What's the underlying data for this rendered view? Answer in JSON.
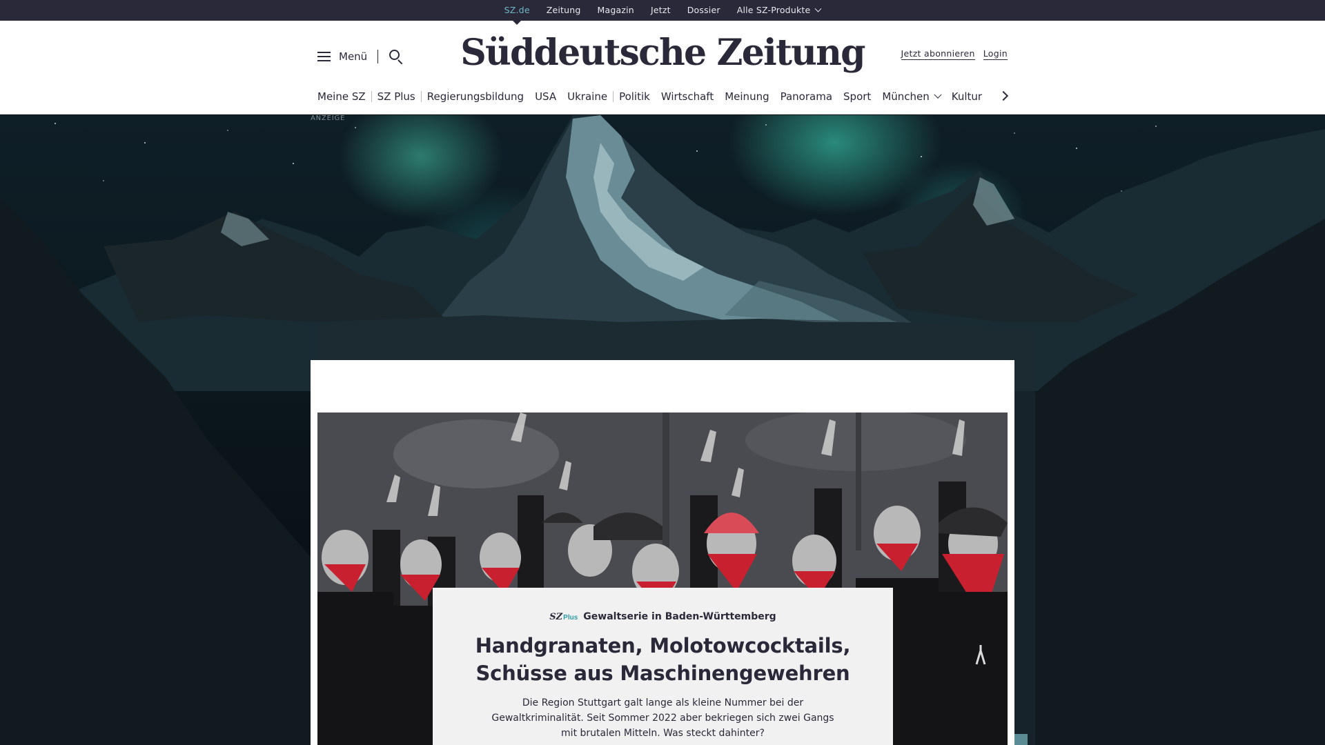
{
  "topbar": {
    "links": [
      "SZ.de",
      "Zeitung",
      "Magazin",
      "Jetzt",
      "Dossier"
    ],
    "products_label": "Alle SZ-Produkte"
  },
  "header": {
    "menu_label": "Menü",
    "logo_text": "Süddeutsche Zeitung",
    "subscribe_label": "Jetzt abonnieren",
    "login_label": "Login"
  },
  "nav": {
    "items": [
      "Meine SZ",
      "SZ Plus",
      "Regierungsbildung",
      "USA",
      "Ukraine",
      "Politik",
      "Wirtschaft",
      "Meinung",
      "Panorama",
      "Sport",
      "München",
      "Kultur"
    ]
  },
  "ad": {
    "label": "ANZEIGE"
  },
  "teaser": {
    "badge_brand": "SZ",
    "badge_plus": "Plus",
    "kicker": "Gewaltserie in Baden-Württemberg",
    "headline_line1": "Handgranaten, Molotowcocktails,",
    "headline_line2": "Schüsse aus Maschinengewehren",
    "summary": "Die Region Stuttgart galt lange als kleine Nummer bei der Gewaltkriminalität. Seit Sommer 2022 aber bekriegen sich zwei Gangs mit brutalen Mitteln. Was steckt dahinter?"
  },
  "colors": {
    "brand_dark": "#29293a",
    "accent_teal": "#6fb9c9",
    "plus_teal": "#2e9aa8",
    "bandana_red": "#c8202f"
  }
}
